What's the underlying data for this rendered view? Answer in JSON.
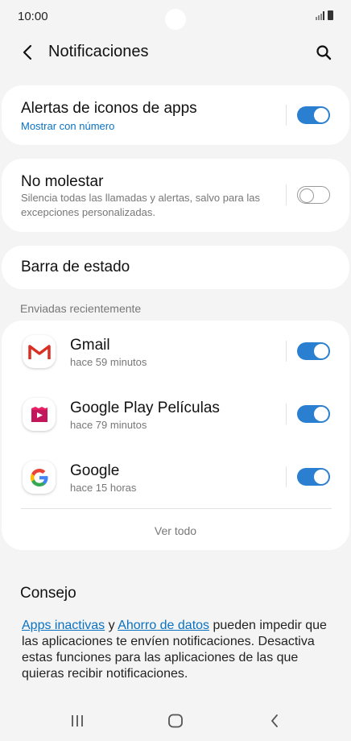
{
  "status_bar": {
    "time": "10:00",
    "icons": [
      "signal-icon",
      "battery-icon"
    ]
  },
  "header": {
    "title": "Notificaciones",
    "back_icon": "back-arrow-icon",
    "search_icon": "search-icon"
  },
  "settings": {
    "badge_alerts": {
      "title": "Alertas de iconos de apps",
      "subtitle": "Mostrar con número",
      "enabled": true
    },
    "do_not_disturb": {
      "title": "No molestar",
      "description": "Silencia todas las llamadas y alertas, salvo para las excepciones personalizadas.",
      "enabled": false
    },
    "status_bar": {
      "title": "Barra de estado"
    }
  },
  "recent": {
    "label": "Enviadas recientemente",
    "apps": [
      {
        "name": "Gmail",
        "time": "hace 59 minutos",
        "icon": "gmail-icon",
        "enabled": true
      },
      {
        "name": "Google Play Películas",
        "time": "hace 79 minutos",
        "icon": "google-play-movies-icon",
        "enabled": true
      },
      {
        "name": "Google",
        "time": "hace 15 horas",
        "icon": "google-icon",
        "enabled": true
      }
    ],
    "see_all": "Ver todo"
  },
  "tip": {
    "title": "Consejo",
    "link1": "Apps inactivas",
    "conj": " y ",
    "link2": "Ahorro de datos",
    "text": " pueden impedir que las aplicaciones te envíen notificaciones. Desactiva estas funciones para las aplicaciones de las que quieras recibir notificaciones."
  },
  "nav": {
    "recents_icon": "recent-apps-icon",
    "home_icon": "home-icon",
    "back_icon": "back-icon"
  },
  "colors": {
    "accent": "#2b7fd1",
    "link": "#0a72c2",
    "background": "#f4f4f4"
  }
}
